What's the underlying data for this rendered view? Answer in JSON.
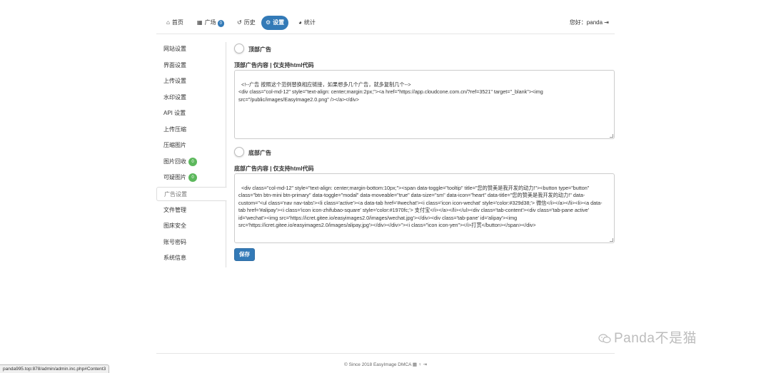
{
  "nav": {
    "items": [
      {
        "label": "首页",
        "icon": "home-icon",
        "glyph": "⌂"
      },
      {
        "label": "广场",
        "icon": "grid-icon",
        "glyph": "▦",
        "badge": "0"
      },
      {
        "label": "历史",
        "icon": "history-icon",
        "glyph": "↺"
      },
      {
        "label": "设置",
        "icon": "gear-icon",
        "glyph": "⚙"
      },
      {
        "label": "统计",
        "icon": "pie-chart-icon",
        "glyph": "◕"
      }
    ],
    "greeting": "您好：panda",
    "logout_glyph": "⇥",
    "active_color": "#337ab7"
  },
  "sidebar": {
    "items": [
      {
        "label": "网站设置"
      },
      {
        "label": "界面设置"
      },
      {
        "label": "上传设置"
      },
      {
        "label": "水印设置"
      },
      {
        "label": "API 设置"
      },
      {
        "label": "上传压缩"
      },
      {
        "label": "压缩图片"
      },
      {
        "label": "图片回收",
        "badge": "0"
      },
      {
        "label": "可疑图片",
        "badge": "0"
      },
      {
        "label": "广告设置"
      },
      {
        "label": "文件管理"
      },
      {
        "label": "图床安全"
      },
      {
        "label": "账号密码"
      },
      {
        "label": "系统信息"
      }
    ],
    "badge_color": "#5cb85c"
  },
  "top_ad": {
    "toggle_label": "顶部广告",
    "field_label": "顶部广告内容 | 仅支持html代码",
    "content": "<!--广告 按照这个范例替换相应链接，如果想多几个广告，就多复制几个-->\n<div class=\"col-md-12\" style=\"text-align: center;margin:2px;\"><a href=\"https://app.cloudcone.com.cn/?ref=3521\" target=\"_blank\"><img\nsrc=\"/public/images/EasyImage2.0.png\" /></a></div>"
  },
  "bottom_ad": {
    "toggle_label": "底部广告",
    "field_label": "底部广告内容 | 仅支持html代码",
    "content": "<div class=\"col-md-12\" style=\"text-align: center;margin-bottom:10px;\"><span data-toggle=\"tooltip\" title=\"您的赞美是我开发的动力!\"><button type=\"button\"\nclass=\"btn btn-mini btn-primary\" data-toggle=\"modal\" data-moveable=\"true\" data-size=\"sm\" data-icon=\"heart\" data-title=\"您的赞美是我开发的动力!\" data-\ncustom=\"<ul class='nav nav-tabs'><li class='active'><a data-tab href='#wechat'><i class='icon icon-wechat' style='color:#329d38;'> 微信</i></a></li><li><a data-\ntab href='#alipay'><i class='icon icon-zhifubao-square' style='color:#1970fc;'> 支付宝</i></a></li></ul><div class='tab-content'><div class='tab-pane active'\nid='wechat'><img src='https://icret.gitee.io/easyimages2.0/images/wechat.jpg'></div><div class='tab-pane' id='alipay'><img\nsrc='https://icret.gitee.io/easyimages2.0/images/alipay.jpg'></div></div>\"><i class=\"icon icon-yen\"></i>打赏</button></span></div>"
  },
  "save_label": "保存",
  "footer": {
    "text": "© Since 2018 EasyImage DMCA",
    "icons": "▦ ♀ ⇥"
  },
  "watermark": "Panda不是猫",
  "statusbar": "panda995.top:878/admin/admin.inc.php#Content3"
}
